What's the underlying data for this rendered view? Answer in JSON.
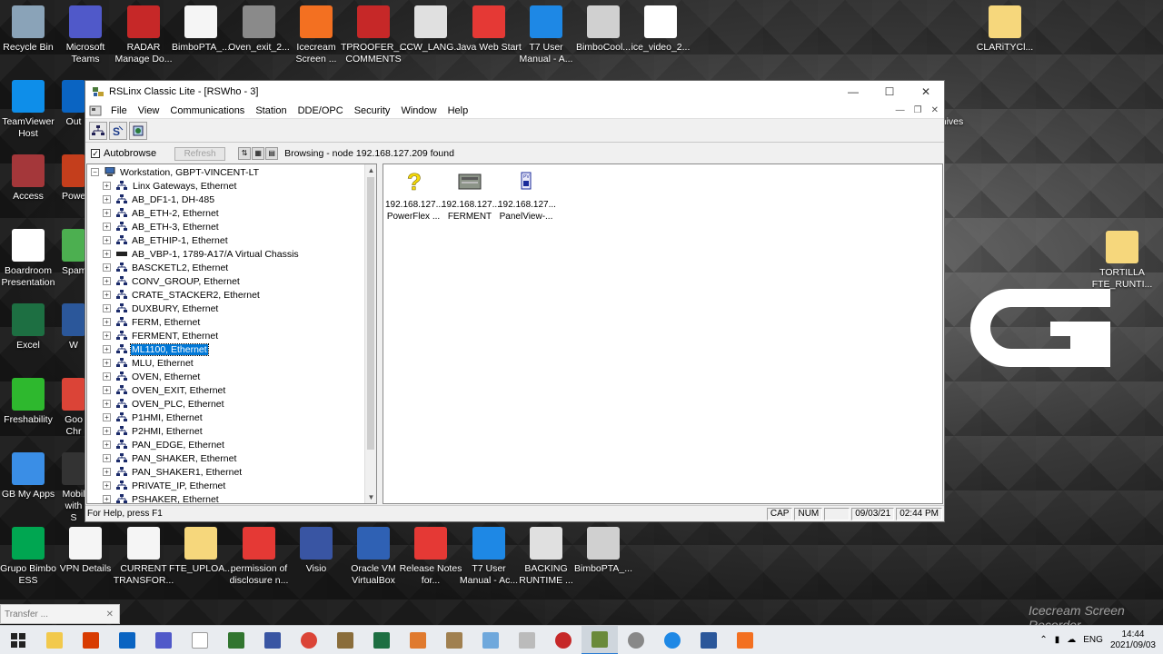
{
  "desktop": {
    "icons_top": [
      {
        "label": "Recycle Bin",
        "icon": "recycle-bin-icon",
        "color": "#8aa3b8"
      },
      {
        "label": "Microsoft Teams",
        "icon": "teams-icon",
        "color": "#5059c9"
      },
      {
        "label": "RADAR Manage Do...",
        "icon": "download-icon",
        "color": "#c62828"
      },
      {
        "label": "BimboPTA_...",
        "icon": "file-icon",
        "color": "#f5f5f5"
      },
      {
        "label": "Oven_exit_2...",
        "icon": "gear-icon",
        "color": "#8a8a8a"
      },
      {
        "label": "Icecream Screen ...",
        "icon": "icecream-icon",
        "color": "#f37021"
      },
      {
        "label": "TPROOFER_... COMMENTS",
        "icon": "ladder-icon",
        "color": "#c62828"
      },
      {
        "label": "CCW_LANG...",
        "icon": "window-icon",
        "color": "#e0e0e0"
      },
      {
        "label": "Java Web Start",
        "icon": "java-icon",
        "color": "#e53935"
      },
      {
        "label": "T7 User Manual - A...",
        "icon": "edge-icon",
        "color": "#1e88e5"
      },
      {
        "label": "BimboCool...",
        "icon": "project-icon",
        "color": "#d0d0d0"
      },
      {
        "label": "ice_video_2...",
        "icon": "video-file-icon",
        "color": "#ffffff"
      },
      {
        "label": "CLARiTYCl...",
        "icon": "folder-icon",
        "color": "#f6d77c"
      }
    ],
    "icons_left": [
      {
        "label": "TeamViewer Host",
        "icon": "teamviewer-icon",
        "color": "#0e8ee9"
      },
      {
        "label": "Access",
        "icon": "access-icon",
        "color": "#a4373a"
      },
      {
        "label": "Boardroom Presentation",
        "icon": "via-icon",
        "color": "#ffffff"
      },
      {
        "label": "Excel",
        "icon": "excel-icon",
        "color": "#1d6f42"
      },
      {
        "label": "Freshability",
        "icon": "freshability-icon",
        "color": "#2eb82e"
      },
      {
        "label": "GB My Apps",
        "icon": "apps-icon",
        "color": "#3a8ee6"
      }
    ],
    "icons_col2": [
      {
        "label": "Out",
        "icon": "outlook-icon",
        "color": "#0a64c2"
      },
      {
        "label": "Powe",
        "icon": "powerpoint-icon",
        "color": "#c43e1c"
      },
      {
        "label": "Spam",
        "icon": "chrome-icon",
        "color": "#4caf50"
      },
      {
        "label": "W",
        "icon": "word-icon",
        "color": "#2b579a"
      },
      {
        "label": "Goo Chr",
        "icon": "chrome-icon",
        "color": "#db4437"
      },
      {
        "label": "Mobil with S",
        "icon": "mobile-icon",
        "color": "#333333"
      }
    ],
    "icons_bottom": [
      {
        "label": "Grupo Bimbo ESS",
        "icon": "sage-icon",
        "color": "#00a651"
      },
      {
        "label": "VPN Details",
        "icon": "file-icon",
        "color": "#f5f5f5"
      },
      {
        "label": "CURRENT TRANSFOR...",
        "icon": "doc-icon",
        "color": "#f5f5f5"
      },
      {
        "label": "FTE_UPLOA...",
        "icon": "folder-icon",
        "color": "#f6d77c"
      },
      {
        "label": "permission of disclosure n...",
        "icon": "pdf-icon",
        "color": "#e53935"
      },
      {
        "label": "Visio",
        "icon": "visio-icon",
        "color": "#3955a3"
      },
      {
        "label": "Oracle VM VirtualBox",
        "icon": "virtualbox-icon",
        "color": "#2f61b4"
      },
      {
        "label": "Release Notes for...",
        "icon": "pdf-icon",
        "color": "#e53935"
      },
      {
        "label": "T7 User Manual - Ac...",
        "icon": "edge-icon",
        "color": "#1e88e5"
      },
      {
        "label": "BACKING RUNTIME ...",
        "icon": "window-icon",
        "color": "#e0e0e0"
      },
      {
        "label": "BimboPTA_...",
        "icon": "project-icon",
        "color": "#d0d0d0"
      }
    ],
    "right_icons": [
      {
        "label": "CLARiTYCl...",
        "icon": "folder-icon"
      },
      {
        "label": "TORTILLA FTE_RUNTI...",
        "icon": "folder-icon"
      }
    ],
    "partial_label": "hives"
  },
  "window": {
    "title": "RSLinx Classic Lite - [RSWho - 3]",
    "menu": [
      "File",
      "View",
      "Communications",
      "Station",
      "DDE/OPC",
      "Security",
      "Window",
      "Help"
    ],
    "browse": {
      "autobrowse_label": "Autobrowse",
      "autobrowse_checked": "✓",
      "refresh_label": "Refresh",
      "status": "Browsing - node 192.168.127.209 found"
    },
    "tree": {
      "root": "Workstation, GBPT-VINCENT-LT",
      "items": [
        "Linx Gateways, Ethernet",
        "AB_DF1-1, DH-485",
        "AB_ETH-2, Ethernet",
        "AB_ETH-3, Ethernet",
        "AB_ETHIP-1, Ethernet",
        "AB_VBP-1, 1789-A17/A Virtual Chassis",
        "BASCKETL2, Ethernet",
        "CONV_GROUP, Ethernet",
        "CRATE_STACKER2, Ethernet",
        "DUXBURY, Ethernet",
        "FERM, Ethernet",
        "FERMENT, Ethernet",
        "ML1100, Ethernet",
        "MLU, Ethernet",
        "OVEN, Ethernet",
        "OVEN_EXIT, Ethernet",
        "OVEN_PLC, Ethernet",
        "P1HMI, Ethernet",
        "P2HMI, Ethernet",
        "PAN_EDGE, Ethernet",
        "PAN_SHAKER, Ethernet",
        "PAN_SHAKER1, Ethernet",
        "PRIVATE_IP, Ethernet",
        "PSHAKER, Ethernet"
      ],
      "selected": "ML1100, Ethernet"
    },
    "devices": [
      {
        "ip": "192.168.127...",
        "name": "PowerFlex ...",
        "icon": "unknown-device-icon"
      },
      {
        "ip": "192.168.127...",
        "name": "FERMENT",
        "icon": "plc-device-icon"
      },
      {
        "ip": "192.168.127...",
        "name": "PanelView-...",
        "icon": "panelview-icon"
      }
    ],
    "statusbar": {
      "help": "For Help, press F1",
      "cap": "CAP",
      "num": "NUM",
      "date": "09/03/21",
      "time": "02:44 PM"
    }
  },
  "taskbar": {
    "mini_task": "Transfer ...",
    "clock_time": "14:44",
    "clock_date": "2021/09/03",
    "lang": "ENG",
    "watermark": "Icecream Screen Recorder"
  }
}
